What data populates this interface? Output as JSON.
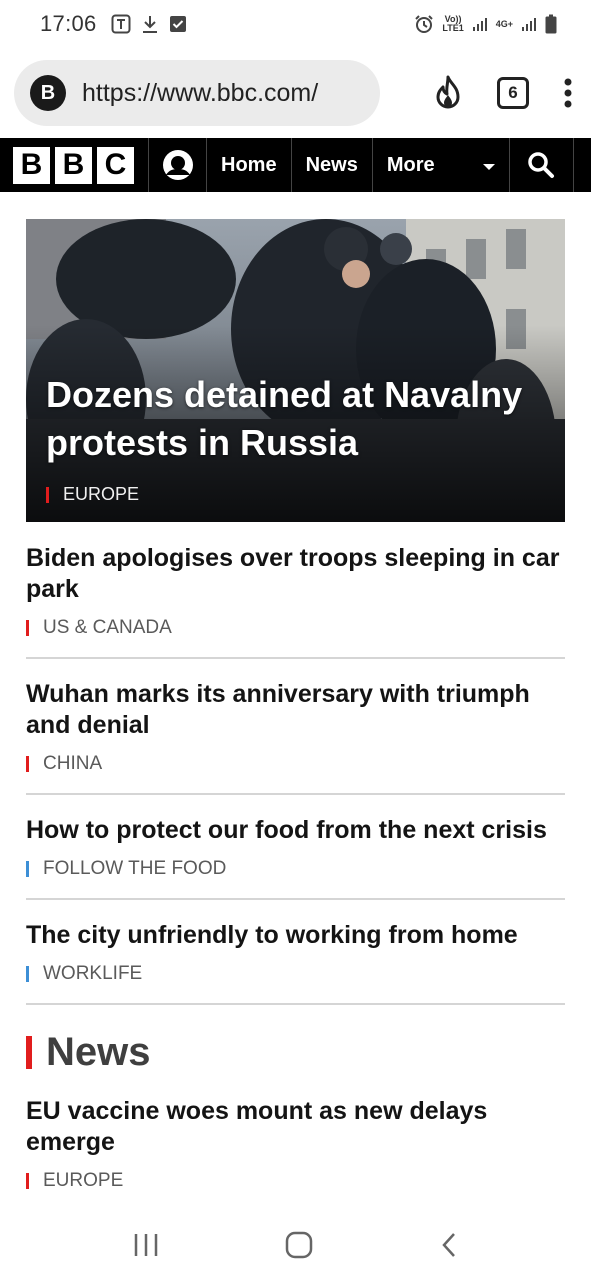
{
  "status_bar": {
    "time": "17:06",
    "left_icons": [
      "teams-icon",
      "download-icon",
      "checkbox-icon"
    ],
    "volte_label_top": "Vo))",
    "volte_label_bottom": "LTE1",
    "network_label": "4G+",
    "right_icons": [
      "alarm-icon",
      "signal-icon",
      "signal-icon",
      "battery-icon"
    ]
  },
  "browser": {
    "site_badge": "B",
    "url": "https://www.bbc.com/",
    "tab_count": "6",
    "actions": [
      "flame-icon",
      "tabs-icon",
      "more-vert-icon"
    ]
  },
  "bbc_nav": {
    "logo_letters": [
      "B",
      "B",
      "C"
    ],
    "items": [
      "Home",
      "News",
      "More"
    ],
    "icons": [
      "user-icon",
      "search-icon"
    ]
  },
  "hero": {
    "title": "Dozens detained at Navalny protests in Russia",
    "tag": "EUROPE",
    "tag_color": "#e11d1d"
  },
  "stories": [
    {
      "title": "Biden apologises over troops sleeping in car park",
      "tag": "US & CANADA",
      "tag_color": "#e11d1d"
    },
    {
      "title": "Wuhan marks its anniversary with triumph and denial",
      "tag": "CHINA",
      "tag_color": "#e11d1d"
    },
    {
      "title": "How to protect our food from the next crisis",
      "tag": "FOLLOW THE FOOD",
      "tag_color": "#3d8fd6"
    },
    {
      "title": "The city unfriendly to working from home",
      "tag": "WORKLIFE",
      "tag_color": "#3d8fd6"
    }
  ],
  "news_section": {
    "heading": "News",
    "story": {
      "title": "EU vaccine woes mount as new delays emerge",
      "tag": "EUROPE",
      "tag_color": "#e11d1d"
    }
  },
  "system_nav": {
    "icons": [
      "recents-icon",
      "home-icon",
      "back-icon"
    ]
  }
}
